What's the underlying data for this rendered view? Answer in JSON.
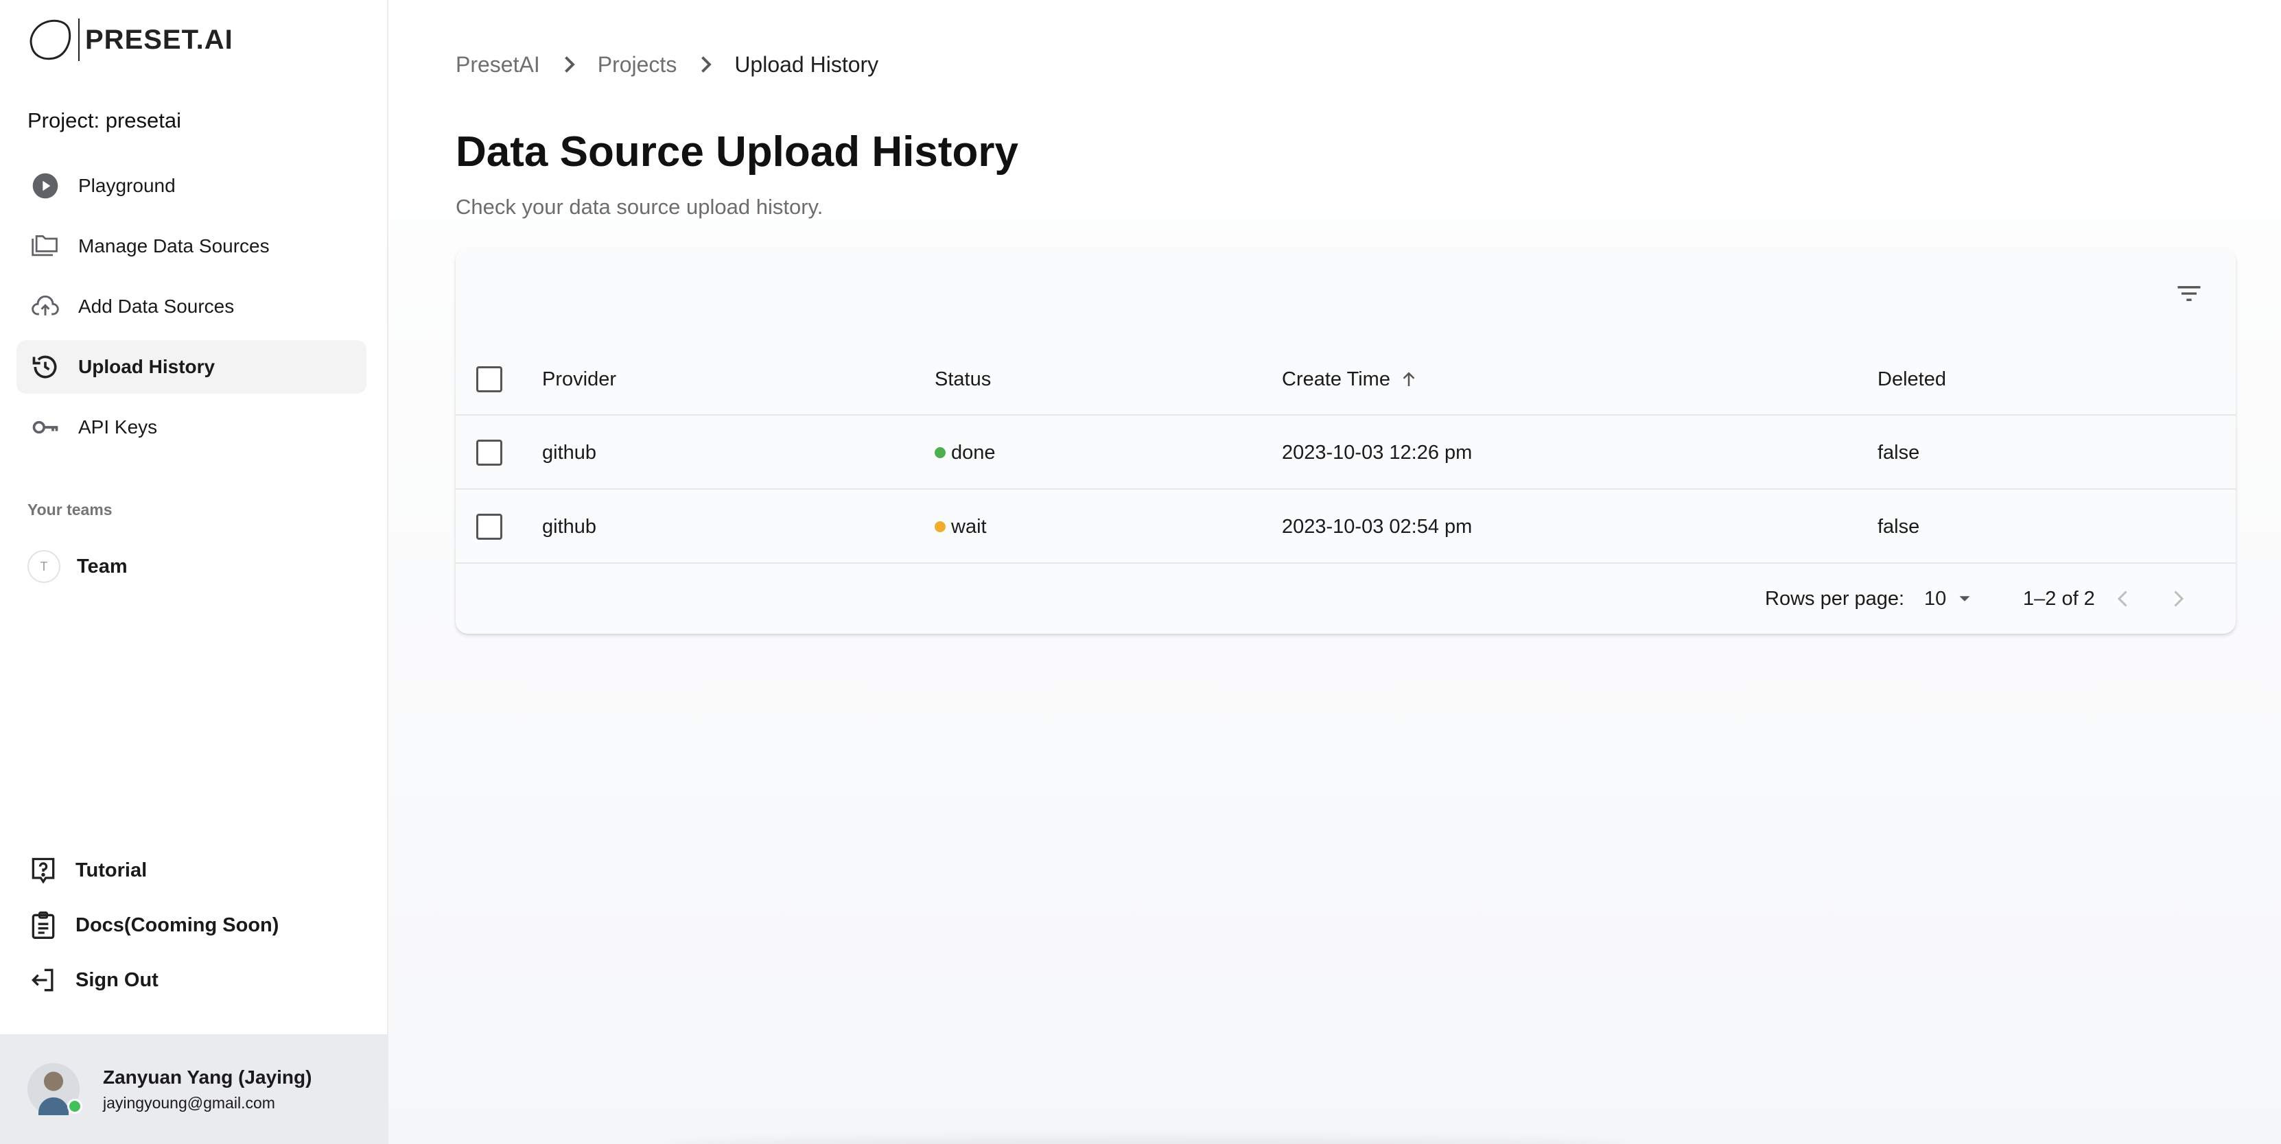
{
  "brand": {
    "name": "PRESET.AI"
  },
  "sidebar": {
    "project_label": "Project: presetai",
    "nav_items": [
      {
        "label": "Playground",
        "icon": "play-circle-icon"
      },
      {
        "label": "Manage Data Sources",
        "icon": "folders-icon"
      },
      {
        "label": "Add Data Sources",
        "icon": "cloud-upload-icon"
      },
      {
        "label": "Upload History",
        "icon": "history-icon",
        "active": true
      },
      {
        "label": "API Keys",
        "icon": "key-icon"
      }
    ],
    "teams_heading": "Your teams",
    "team": {
      "initial": "T",
      "label": "Team"
    },
    "bottom_items": [
      {
        "label": "Tutorial",
        "icon": "help-icon"
      },
      {
        "label": "Docs(Cooming Soon)",
        "icon": "clipboard-icon"
      },
      {
        "label": "Sign Out",
        "icon": "sign-out-icon"
      }
    ],
    "user": {
      "name": "Zanyuan Yang (Jaying)",
      "email": "jayingyoung@gmail.com"
    }
  },
  "breadcrumb": [
    "PresetAI",
    "Projects",
    "Upload History"
  ],
  "page": {
    "title": "Data Source Upload History",
    "subtitle": "Check your data source upload history."
  },
  "table": {
    "columns": {
      "provider": "Provider",
      "status": "Status",
      "create_time": "Create Time",
      "deleted": "Deleted"
    },
    "rows": [
      {
        "provider": "github",
        "status": "done",
        "status_color": "#4caf50",
        "create_time": "2023-10-03 12:26 pm",
        "deleted": "false"
      },
      {
        "provider": "github",
        "status": "wait",
        "status_color": "#f0ad2e",
        "create_time": "2023-10-03 02:54 pm",
        "deleted": "false"
      }
    ],
    "pagination": {
      "rows_per_page_label": "Rows per page:",
      "rows_per_page": "10",
      "range": "1–2 of 2"
    }
  }
}
